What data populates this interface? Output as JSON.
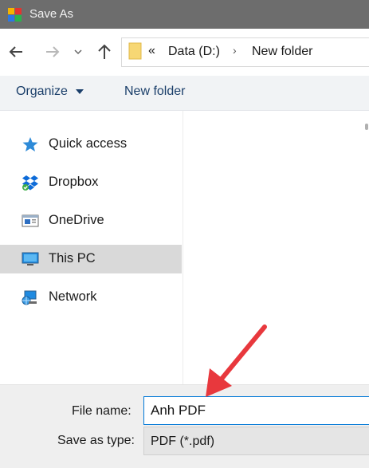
{
  "window": {
    "title": "Save As"
  },
  "breadcrumb": {
    "overflow": "«",
    "items": [
      "Data (D:)",
      "New folder"
    ]
  },
  "toolbar": {
    "organize_label": "Organize",
    "new_folder_label": "New folder"
  },
  "sidebar": {
    "items": [
      {
        "label": "Quick access",
        "icon": "star-icon"
      },
      {
        "label": "Dropbox",
        "icon": "dropbox-icon"
      },
      {
        "label": "OneDrive",
        "icon": "onedrive-icon"
      },
      {
        "label": "This PC",
        "icon": "monitor-icon",
        "selected": true
      },
      {
        "label": "Network",
        "icon": "network-icon"
      }
    ]
  },
  "form": {
    "filename_label": "File name:",
    "filename_value": "Anh PDF",
    "savetype_label": "Save as type:",
    "savetype_value": "PDF (*.pdf)"
  },
  "colors": {
    "annotation_arrow": "#e8383d",
    "titlebar": "#6d6d6d",
    "selection": "#d9d9d9"
  }
}
